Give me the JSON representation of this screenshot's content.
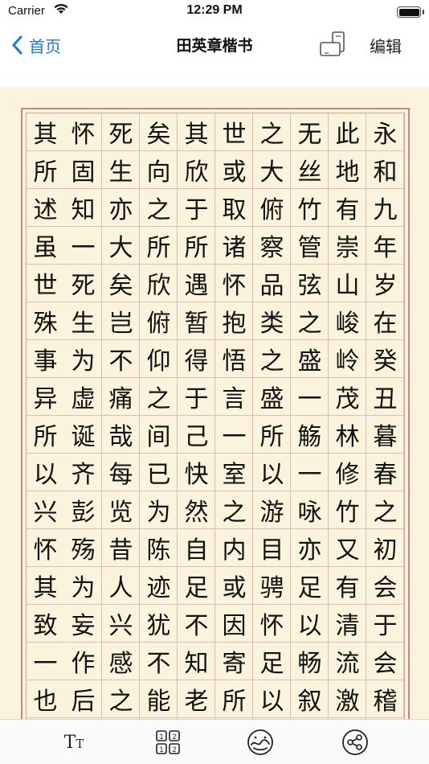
{
  "status_bar": {
    "carrier": "Carrier",
    "time": "12:29 PM",
    "battery_level": 1.0
  },
  "nav": {
    "back_label": "首页",
    "title": "田英章楷书",
    "edit_label": "编辑",
    "accent_color": "#1f7ae0",
    "orientation_icon": "rotate-device-icon"
  },
  "page": {
    "background_color": "#fbf4dc",
    "grid_color": "#c98383",
    "columns": [
      [
        "永",
        "和",
        "九",
        "年",
        "岁",
        "在",
        "癸",
        "丑",
        "暮",
        "春",
        "之",
        "初",
        "会",
        "于",
        "会",
        "稽"
      ],
      [
        "此",
        "地",
        "有",
        "崇",
        "山",
        "峻",
        "岭",
        "茂",
        "林",
        "修",
        "竹",
        "又",
        "有",
        "清",
        "流",
        "激"
      ],
      [
        "无",
        "丝",
        "竹",
        "管",
        "弦",
        "之",
        "盛",
        "一",
        "觞",
        "一",
        "咏",
        "亦",
        "足",
        "以",
        "畅",
        "叙"
      ],
      [
        "之",
        "大",
        "俯",
        "察",
        "品",
        "类",
        "之",
        "盛",
        "所",
        "以",
        "游",
        "目",
        "骋",
        "怀",
        "足",
        "以"
      ],
      [
        "世",
        "或",
        "取",
        "诸",
        "怀",
        "抱",
        "悟",
        "言",
        "一",
        "室",
        "之",
        "内",
        "或",
        "因",
        "寄",
        "所"
      ],
      [
        "其",
        "欣",
        "于",
        "所",
        "遇",
        "暂",
        "得",
        "于",
        "己",
        "快",
        "然",
        "自",
        "足",
        "不",
        "知",
        "老"
      ],
      [
        "矣",
        "向",
        "之",
        "所",
        "欣",
        "俯",
        "仰",
        "之",
        "间",
        "已",
        "为",
        "陈",
        "迹",
        "犹",
        "不",
        "能"
      ],
      [
        "死",
        "生",
        "亦",
        "大",
        "矣",
        "岂",
        "不",
        "痛",
        "哉",
        "每",
        "览",
        "昔",
        "人",
        "兴",
        "感",
        "之"
      ],
      [
        "怀",
        "固",
        "知",
        "一",
        "死",
        "生",
        "为",
        "虚",
        "诞",
        "齐",
        "彭",
        "殇",
        "为",
        "妄",
        "作",
        "后"
      ],
      [
        "其",
        "所",
        "述",
        "虽",
        "世",
        "殊",
        "事",
        "异",
        "所",
        "以",
        "兴",
        "怀",
        "其",
        "致",
        "一",
        "也"
      ]
    ]
  },
  "toolbar": {
    "font_size_icon": "font-size-icon",
    "font_size_big": "T",
    "font_size_small": "T",
    "grid_icon": "grid-layout-icon",
    "grid_digits": [
      "1",
      "2",
      "1",
      "2"
    ],
    "style_icon": "palette-icon",
    "share_icon": "share-icon"
  }
}
